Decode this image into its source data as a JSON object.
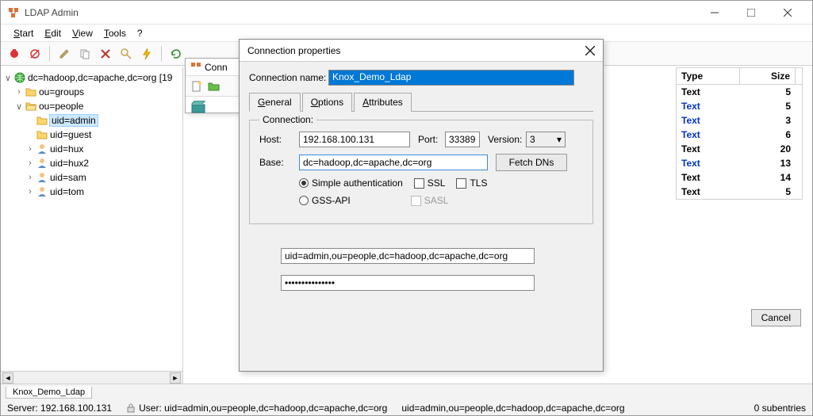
{
  "window": {
    "title": "LDAP Admin"
  },
  "menu": {
    "start": "Start",
    "edit": "Edit",
    "view": "View",
    "tools": "Tools",
    "help": "?"
  },
  "tree": {
    "root": "dc=hadoop,dc=apache,dc=org [19",
    "groups": "ou=groups",
    "people": "ou=people",
    "admin": "uid=admin",
    "guest": "uid=guest",
    "hux": "uid=hux",
    "hux2": "uid=hux2",
    "sam": "uid=sam",
    "tom": "uid=tom"
  },
  "subwin": {
    "title": "Conn"
  },
  "dialog": {
    "title": "Connection properties",
    "name_label": "Connection name:",
    "name_value": "Knox_Demo_Ldap",
    "tabs": {
      "general": "General",
      "options": "Options",
      "attributes": "Attributes"
    },
    "conn_legend": "Connection:",
    "host_label": "Host:",
    "host_value": "192.168.100.131",
    "port_label": "Port:",
    "port_value": "33389",
    "version_label": "Version:",
    "version_value": "3",
    "base_label": "Base:",
    "base_value": "dc=hadoop,dc=apache,dc=org",
    "fetch": "Fetch DNs",
    "auth_simple": "Simple authentication",
    "auth_gss": "GSS-API",
    "ssl": "SSL",
    "tls": "TLS",
    "sasl": "SASL",
    "dn_value": "uid=admin,ou=people,dc=hadoop,dc=apache,dc=org",
    "pw_value": "•••••••••••••••",
    "cancel": "Cancel"
  },
  "attrs": {
    "h1": "Type",
    "h2": "Size",
    "rows": [
      {
        "t": "Text",
        "s": "5",
        "b": false
      },
      {
        "t": "Text",
        "s": "5",
        "b": true
      },
      {
        "t": "Text",
        "s": "3",
        "b": true
      },
      {
        "t": "Text",
        "s": "6",
        "b": true
      },
      {
        "t": "Text",
        "s": "20",
        "b": false
      },
      {
        "t": "Text",
        "s": "13",
        "b": true
      },
      {
        "t": "Text",
        "s": "14",
        "b": false
      },
      {
        "t": "Text",
        "s": "5",
        "b": false
      }
    ]
  },
  "status": {
    "tab": "Knox_Demo_Ldap",
    "server": "Server: 192.168.100.131",
    "user": "User: uid=admin,ou=people,dc=hadoop,dc=apache,dc=org",
    "path": "uid=admin,ou=people,dc=hadoop,dc=apache,dc=org",
    "sub": "0 subentries"
  }
}
